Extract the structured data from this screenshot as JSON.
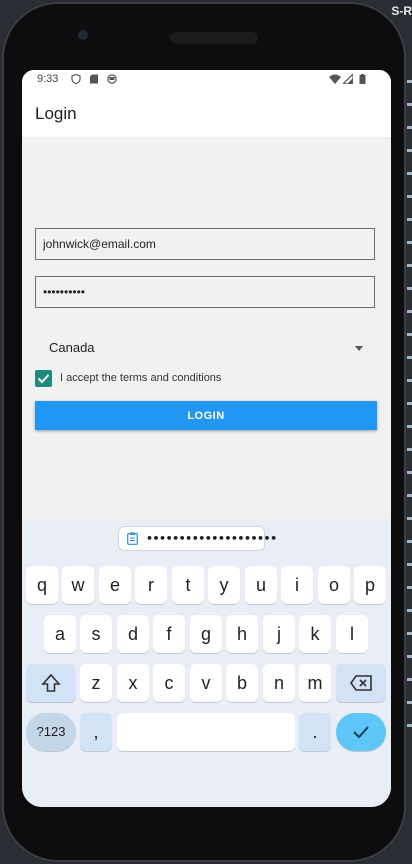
{
  "status_bar": {
    "time": "9:33",
    "left_icons": [
      "shield-icon",
      "sd-card-icon",
      "app-icon"
    ],
    "right_icons": [
      "wifi-icon",
      "signal-icon",
      "battery-icon"
    ]
  },
  "app_bar": {
    "title": "Login"
  },
  "form": {
    "email_value": "johnwick@email.com",
    "password_value": "••••••••••",
    "country_selected": "Canada",
    "terms_label": "I accept the terms and conditions",
    "terms_checked": true,
    "login_label": "LOGIN"
  },
  "keyboard": {
    "suggestion": "••••••••••••••••••••",
    "row1": [
      "q",
      "w",
      "e",
      "r",
      "t",
      "y",
      "u",
      "i",
      "o",
      "p"
    ],
    "row2": [
      "a",
      "s",
      "d",
      "f",
      "g",
      "h",
      "j",
      "k",
      "l"
    ],
    "row3": [
      "z",
      "x",
      "c",
      "v",
      "b",
      "n",
      "m"
    ],
    "symbols_label": "?123",
    "comma_label": ",",
    "period_label": "."
  },
  "colors": {
    "accent": "#2196f3",
    "checkbox": "#1e8a7d",
    "enter_key": "#5ec7f8"
  }
}
